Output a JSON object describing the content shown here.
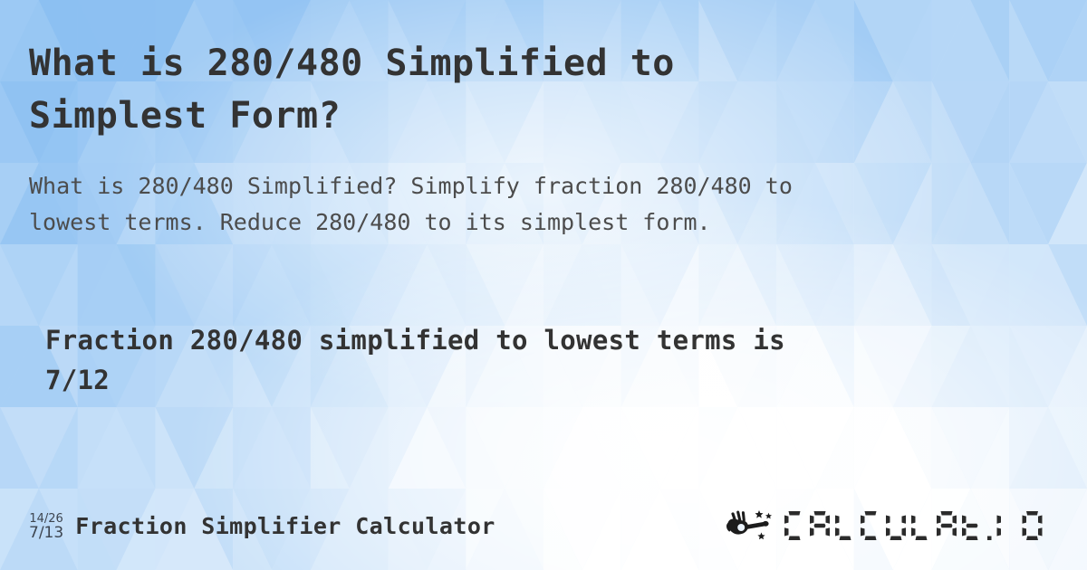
{
  "page": {
    "background_colors": {
      "base": "#bcd9f7",
      "deep_blue": "#8cc0f2",
      "mid_blue": "#a8cff5",
      "light_blue": "#cfe5fb",
      "pale": "#e6f2fd",
      "white": "#ffffff"
    },
    "text_color": "#333333",
    "subtitle_color": "#4c4c4c"
  },
  "title": {
    "line1": "What is 280/480 Simplified to",
    "line2": "Simplest Form?"
  },
  "subtitle": {
    "line1": "What is 280/480 Simplified? Simplify fraction 280/480 to",
    "line2": "lowest terms. Reduce 280/480 to its simplest form."
  },
  "answer": {
    "line1": "Fraction 280/480 simplified to lowest terms is",
    "line2": "7/12"
  },
  "footer": {
    "icon": {
      "name": "fraction-reduce-icon",
      "numerator": "14/26",
      "denominator": "7/13"
    },
    "title": "Fraction Simplifier Calculator",
    "logo": {
      "mark_name": "magic-wand-hand-icon",
      "wordmark": "CALCULAT.IO"
    }
  }
}
